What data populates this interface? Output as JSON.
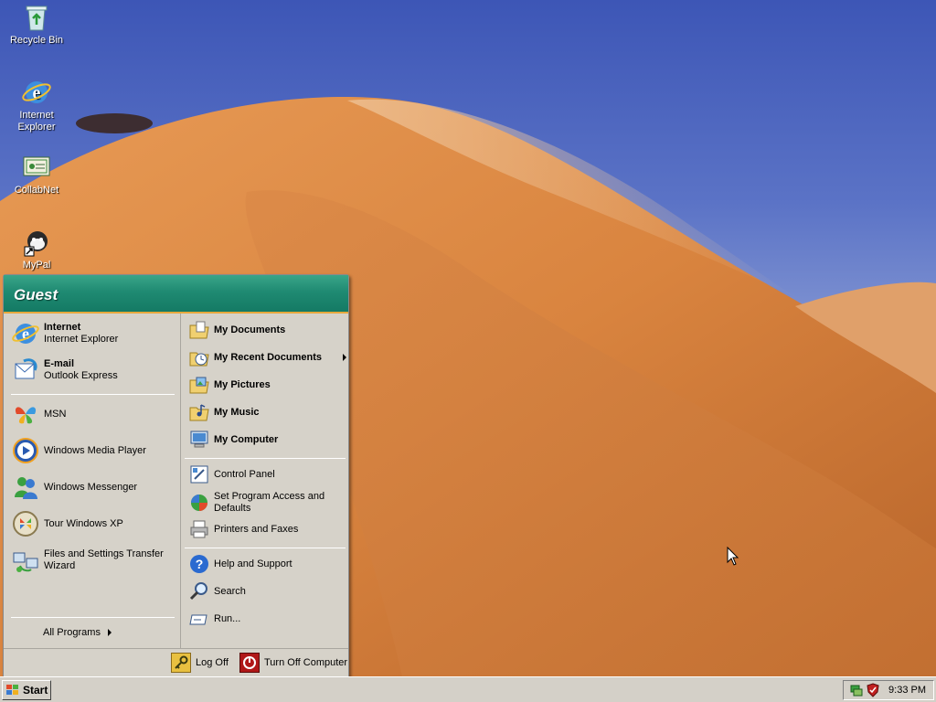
{
  "desktop": {
    "icons": [
      {
        "label": "Recycle Bin",
        "icon": "recycle-bin-icon"
      },
      {
        "label": "Internet Explorer",
        "icon": "internet-explorer-icon"
      },
      {
        "label": "CollabNet",
        "icon": "collabnet-icon"
      },
      {
        "label": "MyPal",
        "icon": "mypal-icon"
      }
    ]
  },
  "start_menu": {
    "user": "Guest",
    "pinned": [
      {
        "title": "Internet",
        "subtitle": "Internet Explorer",
        "icon": "internet-explorer-icon"
      },
      {
        "title": "E-mail",
        "subtitle": "Outlook Express",
        "icon": "outlook-express-icon"
      }
    ],
    "recent": [
      {
        "label": "MSN",
        "icon": "msn-butterfly-icon"
      },
      {
        "label": "Windows Media Player",
        "icon": "media-player-icon"
      },
      {
        "label": "Windows Messenger",
        "icon": "messenger-icon"
      },
      {
        "label": "Tour Windows XP",
        "icon": "tour-icon"
      },
      {
        "label_line1": "Files and Settings Transfer",
        "label_line2": "Wizard",
        "icon": "transfer-wizard-icon"
      }
    ],
    "all_programs": "All Programs",
    "places": [
      {
        "label": "My Documents",
        "icon": "my-documents-icon"
      },
      {
        "label": "My Recent Documents",
        "icon": "recent-documents-icon"
      },
      {
        "label": "My Pictures",
        "icon": "my-pictures-icon"
      },
      {
        "label": "My Music",
        "icon": "my-music-icon"
      },
      {
        "label": "My Computer",
        "icon": "my-computer-icon"
      }
    ],
    "settings": [
      {
        "label": "Control Panel",
        "icon": "control-panel-icon"
      },
      {
        "label_line1": "Set Program Access and",
        "label_line2": "Defaults",
        "icon": "program-access-icon"
      },
      {
        "label": "Printers and Faxes",
        "icon": "printer-icon"
      }
    ],
    "tools": [
      {
        "label": "Help and Support",
        "icon": "help-icon"
      },
      {
        "label": "Search",
        "icon": "search-icon"
      },
      {
        "label": "Run...",
        "icon": "run-icon"
      }
    ],
    "footer": {
      "log_off": "Log Off",
      "turn_off": "Turn Off Computer"
    }
  },
  "taskbar": {
    "start_label": "Start",
    "clock": "9:33 PM"
  },
  "colors": {
    "header_green": "#1f8a72",
    "header_accent": "#e6a83c",
    "menu_bg": "#d6d2c9",
    "sand": "#d88a4a"
  }
}
